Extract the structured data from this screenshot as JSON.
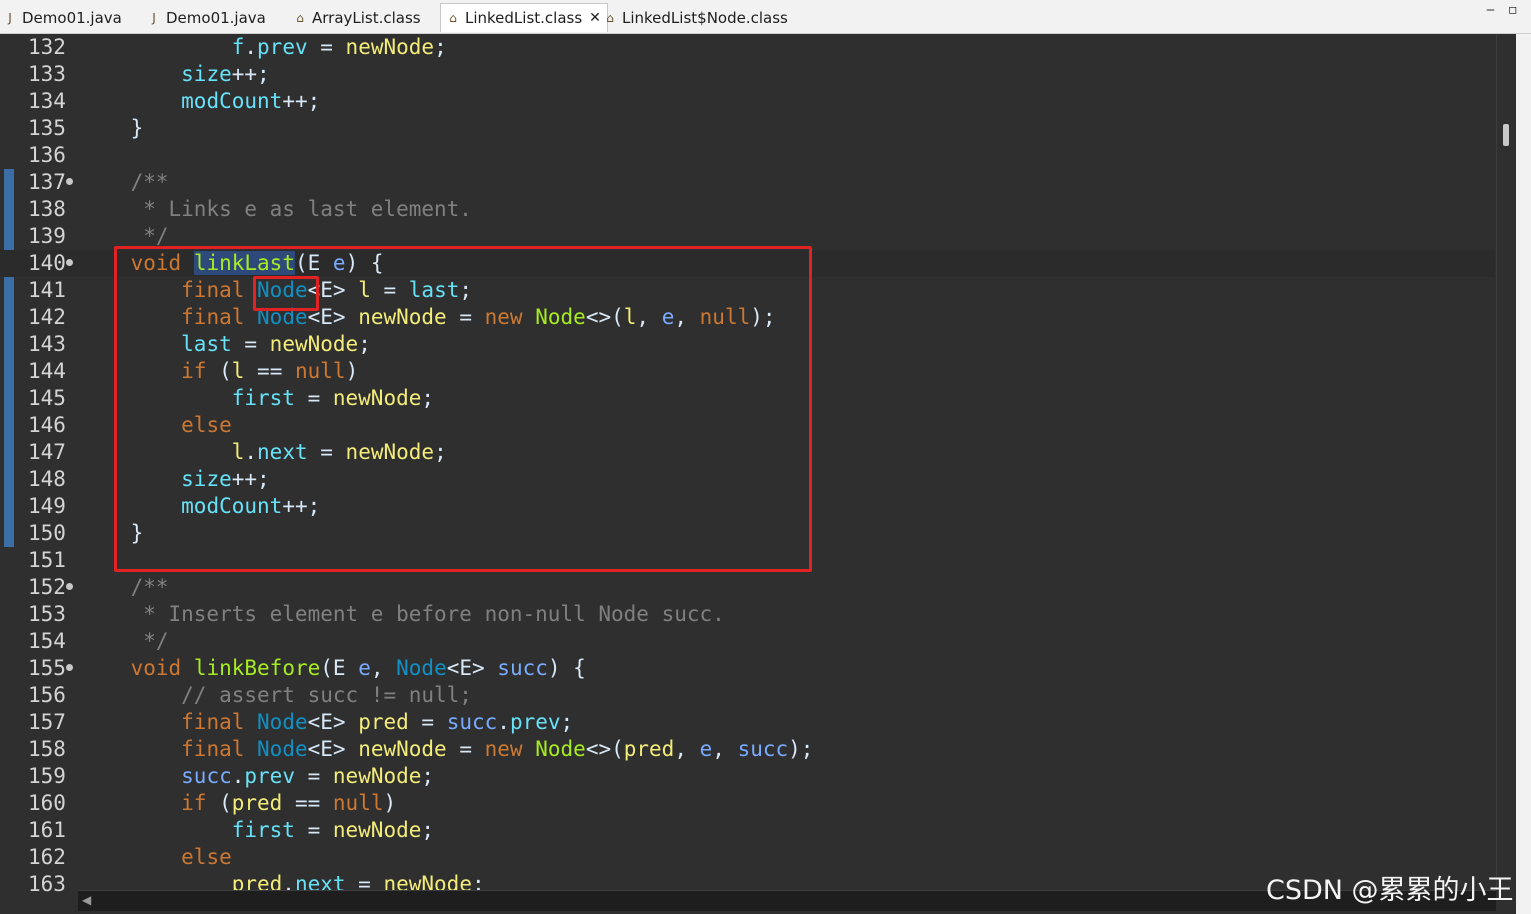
{
  "tabs": [
    {
      "label": "Demo01.java",
      "icon": "java-file-icon"
    },
    {
      "label": "Demo01.java",
      "icon": "java-file-icon"
    },
    {
      "label": "ArrayList.class",
      "icon": "class-file-icon"
    },
    {
      "label": "LinkedList.class",
      "icon": "class-file-icon",
      "active": true,
      "close": "✕"
    },
    {
      "label": "LinkedList$Node.class",
      "icon": "class-file-icon"
    }
  ],
  "window_controls": {
    "minimize": "‒",
    "maximize": "▫"
  },
  "editor": {
    "current_line": 140,
    "lines": [
      {
        "n": "132",
        "tokens": [
          [
            "plain",
            "            "
          ],
          [
            "field",
            "f"
          ],
          [
            "plain",
            "."
          ],
          [
            "field",
            "prev"
          ],
          [
            "plain",
            " = "
          ],
          [
            "local",
            "newNode"
          ],
          [
            "plain",
            ";"
          ]
        ]
      },
      {
        "n": "133",
        "tokens": [
          [
            "plain",
            "        "
          ],
          [
            "field",
            "size"
          ],
          [
            "plain",
            "++;"
          ]
        ]
      },
      {
        "n": "134",
        "tokens": [
          [
            "plain",
            "        "
          ],
          [
            "field",
            "modCount"
          ],
          [
            "plain",
            "++;"
          ]
        ]
      },
      {
        "n": "135",
        "tokens": [
          [
            "plain",
            "    }"
          ]
        ]
      },
      {
        "n": "136",
        "tokens": []
      },
      {
        "n": "137",
        "fold": true,
        "tokens": [
          [
            "plain",
            "    "
          ],
          [
            "comment",
            "/**"
          ]
        ]
      },
      {
        "n": "138",
        "tokens": [
          [
            "comment",
            "     * Links e as last element."
          ]
        ]
      },
      {
        "n": "139",
        "tokens": [
          [
            "comment",
            "     */"
          ]
        ]
      },
      {
        "n": "140",
        "fold": true,
        "tokens": [
          [
            "plain",
            "    "
          ],
          [
            "kw",
            "void"
          ],
          [
            "plain",
            " "
          ],
          [
            "sel",
            "linkLast"
          ],
          [
            "plain",
            "(E "
          ],
          [
            "param",
            "e"
          ],
          [
            "plain",
            ") {"
          ]
        ]
      },
      {
        "n": "141",
        "tokens": [
          [
            "plain",
            "        "
          ],
          [
            "kw",
            "final"
          ],
          [
            "plain",
            " "
          ],
          [
            "type",
            "Node"
          ],
          [
            "plain",
            "<E> "
          ],
          [
            "local",
            "l"
          ],
          [
            "plain",
            " = "
          ],
          [
            "field",
            "last"
          ],
          [
            "plain",
            ";"
          ]
        ]
      },
      {
        "n": "142",
        "tokens": [
          [
            "plain",
            "        "
          ],
          [
            "kw",
            "final"
          ],
          [
            "plain",
            " "
          ],
          [
            "type",
            "Node"
          ],
          [
            "plain",
            "<E> "
          ],
          [
            "local",
            "newNode"
          ],
          [
            "plain",
            " = "
          ],
          [
            "kw",
            "new"
          ],
          [
            "plain",
            " "
          ],
          [
            "green",
            "Node"
          ],
          [
            "plain",
            "<>("
          ],
          [
            "local",
            "l"
          ],
          [
            "plain",
            ", "
          ],
          [
            "param",
            "e"
          ],
          [
            "plain",
            ", "
          ],
          [
            "kw",
            "null"
          ],
          [
            "plain",
            ");"
          ]
        ]
      },
      {
        "n": "143",
        "tokens": [
          [
            "plain",
            "        "
          ],
          [
            "field",
            "last"
          ],
          [
            "plain",
            " = "
          ],
          [
            "local",
            "newNode"
          ],
          [
            "plain",
            ";"
          ]
        ]
      },
      {
        "n": "144",
        "tokens": [
          [
            "plain",
            "        "
          ],
          [
            "kw",
            "if"
          ],
          [
            "plain",
            " ("
          ],
          [
            "local",
            "l"
          ],
          [
            "plain",
            " == "
          ],
          [
            "kw",
            "null"
          ],
          [
            "plain",
            ")"
          ]
        ]
      },
      {
        "n": "145",
        "tokens": [
          [
            "plain",
            "            "
          ],
          [
            "field",
            "first"
          ],
          [
            "plain",
            " = "
          ],
          [
            "local",
            "newNode"
          ],
          [
            "plain",
            ";"
          ]
        ]
      },
      {
        "n": "146",
        "tokens": [
          [
            "plain",
            "        "
          ],
          [
            "kw",
            "else"
          ]
        ]
      },
      {
        "n": "147",
        "tokens": [
          [
            "plain",
            "            "
          ],
          [
            "local",
            "l"
          ],
          [
            "plain",
            "."
          ],
          [
            "field",
            "next"
          ],
          [
            "plain",
            " = "
          ],
          [
            "local",
            "newNode"
          ],
          [
            "plain",
            ";"
          ]
        ]
      },
      {
        "n": "148",
        "tokens": [
          [
            "plain",
            "        "
          ],
          [
            "field",
            "size"
          ],
          [
            "plain",
            "++;"
          ]
        ]
      },
      {
        "n": "149",
        "tokens": [
          [
            "plain",
            "        "
          ],
          [
            "field",
            "modCount"
          ],
          [
            "plain",
            "++;"
          ]
        ]
      },
      {
        "n": "150",
        "tokens": [
          [
            "plain",
            "    }"
          ]
        ]
      },
      {
        "n": "151",
        "tokens": []
      },
      {
        "n": "152",
        "fold": true,
        "tokens": [
          [
            "plain",
            "    "
          ],
          [
            "comment",
            "/**"
          ]
        ]
      },
      {
        "n": "153",
        "tokens": [
          [
            "comment",
            "     * Inserts element e before non-null Node succ."
          ]
        ]
      },
      {
        "n": "154",
        "tokens": [
          [
            "comment",
            "     */"
          ]
        ]
      },
      {
        "n": "155",
        "fold": true,
        "tokens": [
          [
            "plain",
            "    "
          ],
          [
            "kw",
            "void"
          ],
          [
            "plain",
            " "
          ],
          [
            "green",
            "linkBefore"
          ],
          [
            "plain",
            "(E "
          ],
          [
            "param",
            "e"
          ],
          [
            "plain",
            ", "
          ],
          [
            "type",
            "Node"
          ],
          [
            "plain",
            "<E> "
          ],
          [
            "param",
            "succ"
          ],
          [
            "plain",
            ") {"
          ]
        ]
      },
      {
        "n": "156",
        "tokens": [
          [
            "plain",
            "        "
          ],
          [
            "comment",
            "// assert succ != null;"
          ]
        ]
      },
      {
        "n": "157",
        "tokens": [
          [
            "plain",
            "        "
          ],
          [
            "kw",
            "final"
          ],
          [
            "plain",
            " "
          ],
          [
            "type",
            "Node"
          ],
          [
            "plain",
            "<E> "
          ],
          [
            "local",
            "pred"
          ],
          [
            "plain",
            " = "
          ],
          [
            "param",
            "succ"
          ],
          [
            "plain",
            "."
          ],
          [
            "field",
            "prev"
          ],
          [
            "plain",
            ";"
          ]
        ]
      },
      {
        "n": "158",
        "tokens": [
          [
            "plain",
            "        "
          ],
          [
            "kw",
            "final"
          ],
          [
            "plain",
            " "
          ],
          [
            "type",
            "Node"
          ],
          [
            "plain",
            "<E> "
          ],
          [
            "local",
            "newNode"
          ],
          [
            "plain",
            " = "
          ],
          [
            "kw",
            "new"
          ],
          [
            "plain",
            " "
          ],
          [
            "green",
            "Node"
          ],
          [
            "plain",
            "<>("
          ],
          [
            "local",
            "pred"
          ],
          [
            "plain",
            ", "
          ],
          [
            "param",
            "e"
          ],
          [
            "plain",
            ", "
          ],
          [
            "param",
            "succ"
          ],
          [
            "plain",
            ");"
          ]
        ]
      },
      {
        "n": "159",
        "tokens": [
          [
            "plain",
            "        "
          ],
          [
            "param",
            "succ"
          ],
          [
            "plain",
            "."
          ],
          [
            "field",
            "prev"
          ],
          [
            "plain",
            " = "
          ],
          [
            "local",
            "newNode"
          ],
          [
            "plain",
            ";"
          ]
        ]
      },
      {
        "n": "160",
        "tokens": [
          [
            "plain",
            "        "
          ],
          [
            "kw",
            "if"
          ],
          [
            "plain",
            " ("
          ],
          [
            "local",
            "pred"
          ],
          [
            "plain",
            " == "
          ],
          [
            "kw",
            "null"
          ],
          [
            "plain",
            ")"
          ]
        ]
      },
      {
        "n": "161",
        "tokens": [
          [
            "plain",
            "            "
          ],
          [
            "field",
            "first"
          ],
          [
            "plain",
            " = "
          ],
          [
            "local",
            "newNode"
          ],
          [
            "plain",
            ";"
          ]
        ]
      },
      {
        "n": "162",
        "tokens": [
          [
            "plain",
            "        "
          ],
          [
            "kw",
            "else"
          ]
        ]
      },
      {
        "n": "163",
        "tokens": [
          [
            "plain",
            "            "
          ],
          [
            "local",
            "pred"
          ],
          [
            "plain",
            "."
          ],
          [
            "field",
            "next"
          ],
          [
            "plain",
            " = "
          ],
          [
            "local",
            "newNode"
          ],
          [
            "plain",
            ";"
          ]
        ]
      }
    ]
  },
  "watermark": "CSDN @累累的小王"
}
